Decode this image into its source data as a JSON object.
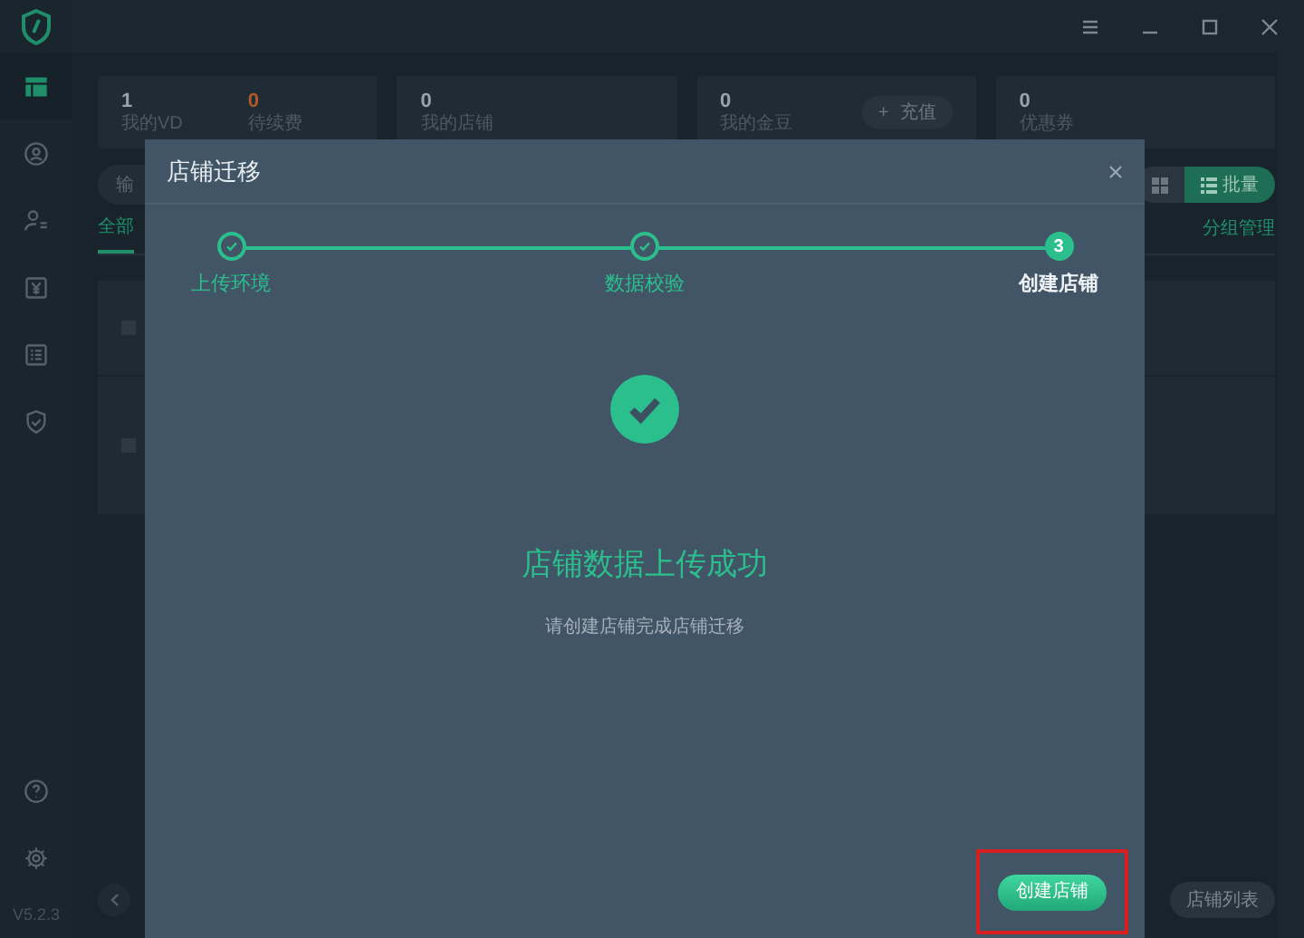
{
  "window": {
    "controls": [
      {
        "kind": "menu"
      },
      {
        "kind": "minimize"
      },
      {
        "kind": "maximize"
      },
      {
        "kind": "close"
      }
    ]
  },
  "sidebar": {
    "items": [
      {
        "kind": "dashboard",
        "selected": true
      },
      {
        "kind": "user",
        "selected": false
      },
      {
        "kind": "team",
        "selected": false
      },
      {
        "kind": "money",
        "selected": false
      },
      {
        "kind": "list",
        "selected": false
      },
      {
        "kind": "shield",
        "selected": false
      }
    ],
    "bottom_items": [
      {
        "kind": "help"
      },
      {
        "kind": "settings"
      }
    ],
    "version": "V5.2.3"
  },
  "stat_cards": [
    {
      "stats": [
        {
          "value": "1",
          "label": "我的VD",
          "kind": "normal"
        },
        {
          "value": "0",
          "label": "待续费",
          "kind": "warning"
        }
      ]
    },
    {
      "stats": [
        {
          "value": "0",
          "label": "我的店铺",
          "kind": "normal"
        }
      ]
    },
    {
      "stats": [
        {
          "value": "0",
          "label": "我的金豆",
          "kind": "normal"
        }
      ],
      "button": {
        "icon": "+",
        "label": "充值"
      }
    },
    {
      "stats": [
        {
          "value": "0",
          "label": "优惠券",
          "kind": "normal"
        }
      ]
    }
  ],
  "search": {
    "placeholder": "输"
  },
  "view_toggle": [
    {
      "kind": "grid",
      "selected": false
    },
    {
      "kind": "list",
      "label": "批量",
      "selected": true
    }
  ],
  "tabs": [
    {
      "label": "全部",
      "selected": true
    }
  ],
  "group_manage": "分组管理",
  "rows": [
    {
      "checked": false,
      "more": false
    },
    {
      "checked": false,
      "more": true
    }
  ],
  "store_list_button": "店铺列表",
  "dialog": {
    "title": "店铺迁移",
    "steps": [
      {
        "label": "上传环境",
        "completed": true
      },
      {
        "label": "数据校验",
        "completed": true
      },
      {
        "label": "创建店铺",
        "completed": false,
        "number": "3"
      }
    ],
    "result_title": "店铺数据上传成功",
    "result_message": "请创建店铺完成店铺迁移",
    "primary_button": {
      "label": "创建店铺",
      "highlighted": true
    }
  }
}
